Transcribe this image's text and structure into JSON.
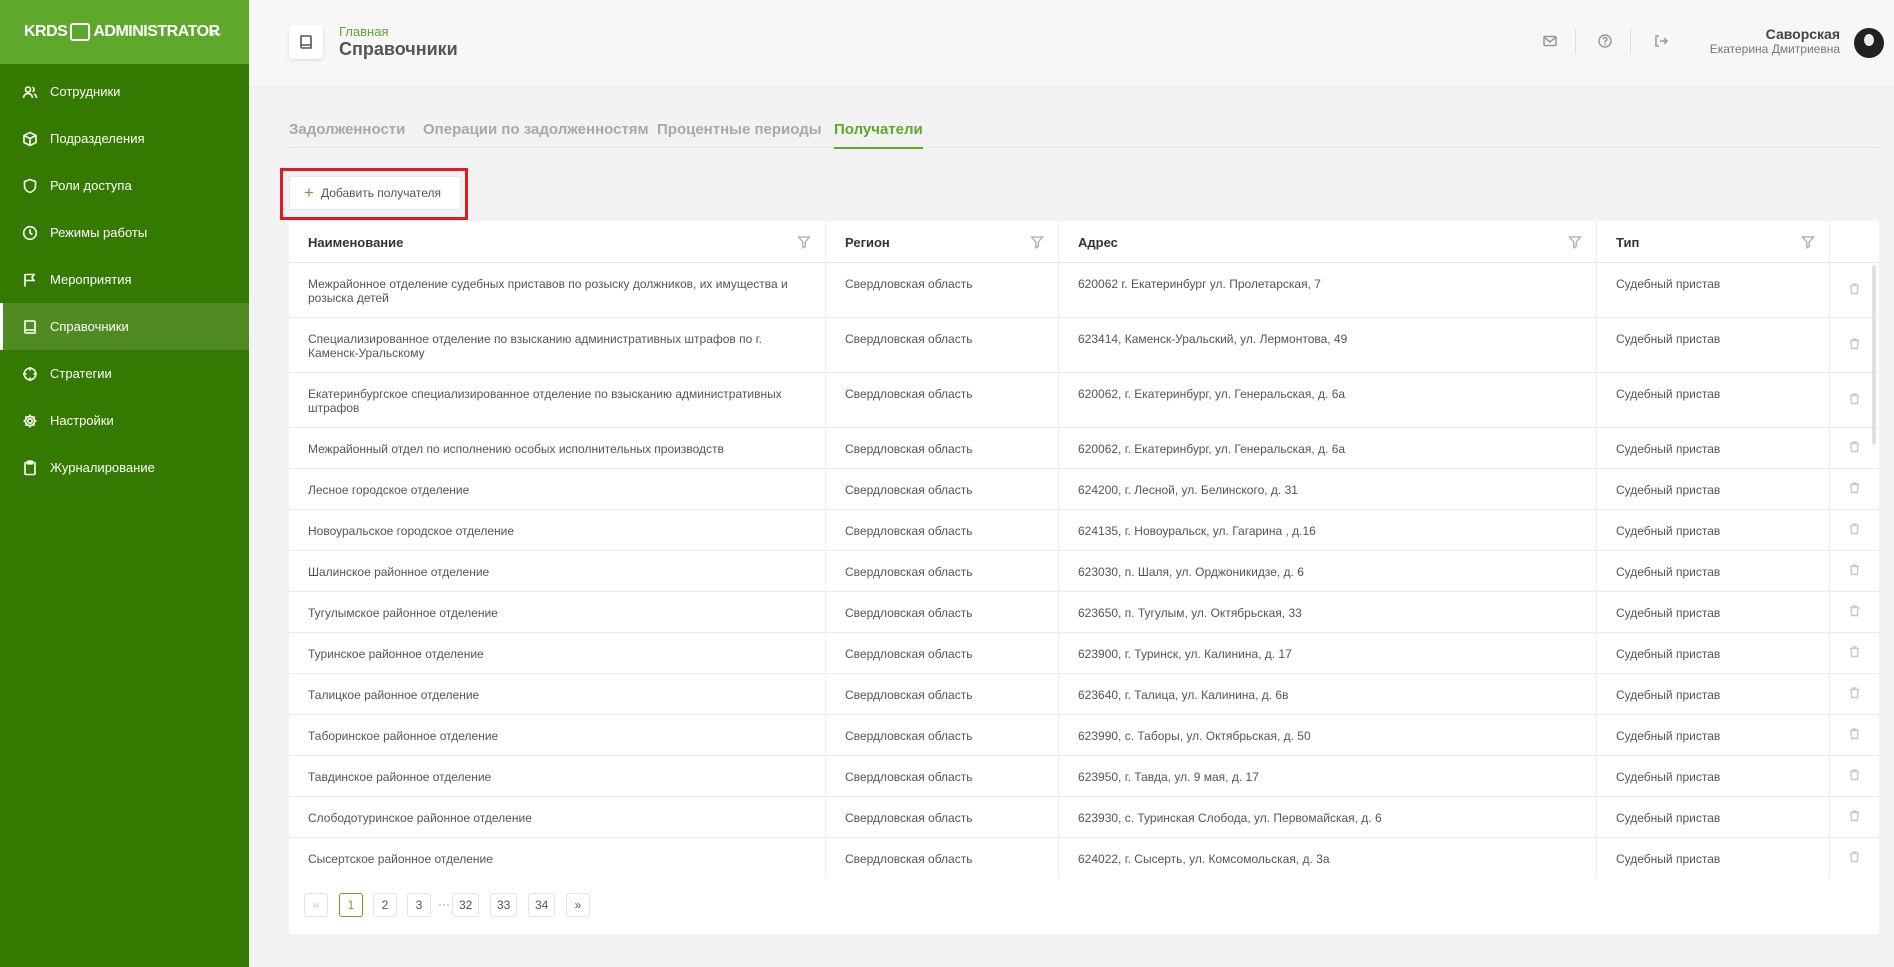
{
  "app": {
    "logo_left": "KRDS",
    "logo_right": "ADMINISTRATOR",
    "collapse_icon": "arrow-left-icon"
  },
  "sidebar": {
    "items": [
      {
        "label": "Сотрудники",
        "icon": "users-icon",
        "active": false
      },
      {
        "label": "Подразделения",
        "icon": "cube-icon",
        "active": false
      },
      {
        "label": "Роли доступа",
        "icon": "shield-icon",
        "active": false
      },
      {
        "label": "Режимы работы",
        "icon": "clock-icon",
        "active": false
      },
      {
        "label": "Мероприятия",
        "icon": "flag-icon",
        "active": false
      },
      {
        "label": "Справочники",
        "icon": "book-icon",
        "active": true
      },
      {
        "label": "Стратегии",
        "icon": "crosshair-icon",
        "active": false
      },
      {
        "label": "Настройки",
        "icon": "gear-icon",
        "active": false
      },
      {
        "label": "Журналирование",
        "icon": "clipboard-icon",
        "active": false
      }
    ]
  },
  "header": {
    "breadcrumb": "Главная",
    "title": "Справочники",
    "user_last_name": "Саворская",
    "user_first_name": "Екатерина Дмитриевна"
  },
  "tabs": [
    {
      "label": "Задолженности",
      "active": false
    },
    {
      "label": "Операции по задолженностям",
      "active": false
    },
    {
      "label": "Процентные периоды",
      "active": false
    },
    {
      "label": "Получатели",
      "active": true
    }
  ],
  "toolbar": {
    "add_label": "Добавить получателя"
  },
  "table": {
    "columns": [
      "Наименование",
      "Регион",
      "Адрес",
      "Тип"
    ],
    "rows": [
      [
        "Межрайонное отделение судебных приставов по розыску должников, их имущества и розыска детей",
        "Свердловская область",
        "620062 г. Екатеринбург ул. Пролетарская, 7",
        "Судебный пристав"
      ],
      [
        "Специализированное отделение по взысканию административных штрафов по г. Каменск-Уральскому",
        "Свердловская область",
        "623414, Каменск-Уральский, ул. Лермонтова, 49",
        "Судебный пристав"
      ],
      [
        "Екатеринбургское специализированное отделение по взысканию административных штрафов",
        "Свердловская область",
        "620062, г. Екатеринбург, ул. Генеральская, д. 6а",
        "Судебный пристав"
      ],
      [
        "Межрайонный отдел по исполнению особых исполнительных производств",
        "Свердловская область",
        "620062, г. Екатеринбург, ул. Генеральская, д. 6а",
        "Судебный пристав"
      ],
      [
        "Лесное городское отделение",
        "Свердловская область",
        "624200, г. Лесной, ул. Белинского, д. 31",
        "Судебный пристав"
      ],
      [
        "Новоуральское городское отделение",
        "Свердловская область",
        "624135, г. Новоуральск, ул. Гагарина , д.16",
        "Судебный пристав"
      ],
      [
        "Шалинское районное отделение",
        "Свердловская область",
        "623030, п. Шаля, ул. Орджоникидзе, д. 6",
        "Судебный пристав"
      ],
      [
        "Тугулымское районное отделение",
        "Свердловская область",
        "623650, п. Тугулым, ул. Октябрьская, 33",
        "Судебный пристав"
      ],
      [
        "Туринское районное отделение",
        "Свердловская область",
        "623900, г. Туринск, ул. Калинина, д. 17",
        "Судебный пристав"
      ],
      [
        "Талицкое районное отделение",
        "Свердловская область",
        "623640, г. Талица, ул. Калинина, д. 6в",
        "Судебный пристав"
      ],
      [
        "Таборинское районное отделение",
        "Свердловская область",
        "623990, с. Таборы, ул. Октябрьская, д. 50",
        "Судебный пристав"
      ],
      [
        "Тавдинское районное отделение",
        "Свердловская область",
        "623950, г. Тавда, ул. 9 мая, д. 17",
        "Судебный пристав"
      ],
      [
        "Слободотуринское районное отделение",
        "Свердловская область",
        "623930, с. Туринская Слобода, ул. Первомайская, д. 6",
        "Судебный пристав"
      ],
      [
        "Сысертское районное отделение",
        "Свердловская область",
        "624022, г. Сысерть, ул. Комсомольская, д. 3а",
        "Судебный пристав"
      ]
    ]
  },
  "pagination": {
    "prev": "«",
    "pages": [
      "1",
      "2",
      "3"
    ],
    "dots": "···",
    "tail_pages": [
      "32",
      "33",
      "34"
    ],
    "next": "»",
    "current": "1"
  }
}
